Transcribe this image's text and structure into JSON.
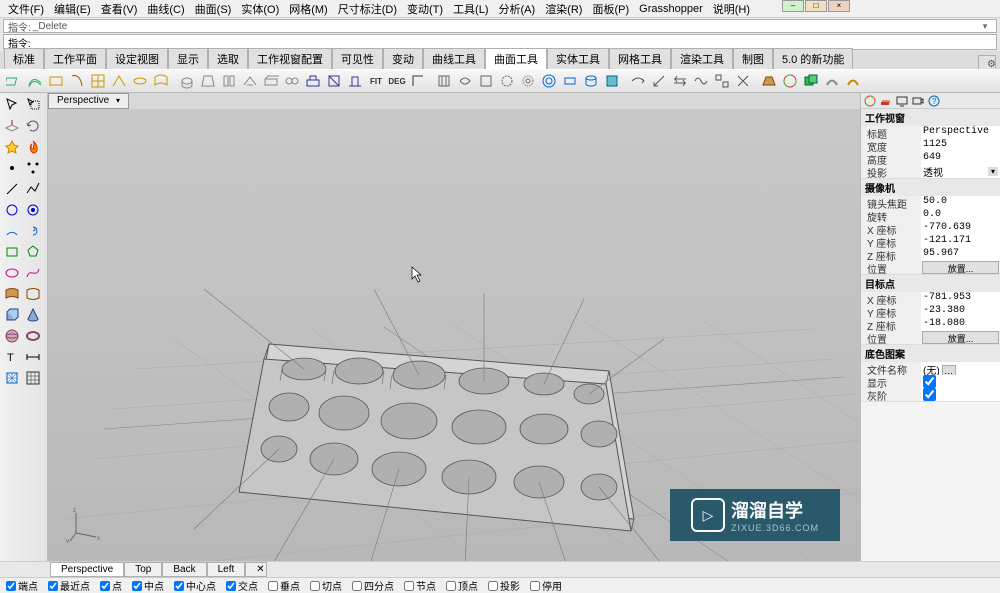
{
  "menu": [
    "文件(F)",
    "编辑(E)",
    "查看(V)",
    "曲线(C)",
    "曲面(S)",
    "实体(O)",
    "网格(M)",
    "尺寸标注(D)",
    "变动(T)",
    "工具(L)",
    "分析(A)",
    "渲染(R)",
    "面板(P)",
    "Grasshopper",
    "说明(H)"
  ],
  "cmd_history": {
    "label": "指令:",
    "last": "_Delete"
  },
  "cmd": {
    "label": "指令:",
    "value": ""
  },
  "tabs": [
    "标准",
    "工作平面",
    "设定视图",
    "显示",
    "选取",
    "工作视窗配置",
    "可见性",
    "变动",
    "曲线工具",
    "曲面工具",
    "实体工具",
    "网格工具",
    "渲染工具",
    "制图",
    "5.0 的新功能"
  ],
  "active_tab": 9,
  "viewport_tab": "Perspective",
  "bottom_tabs": [
    "Perspective",
    "Top",
    "Back",
    "Left"
  ],
  "active_bottom": 0,
  "props": {
    "viewport": {
      "title": "工作视窗",
      "rows": [
        {
          "k": "标题",
          "v": "Perspective"
        },
        {
          "k": "宽度",
          "v": "1125"
        },
        {
          "k": "高度",
          "v": "649"
        },
        {
          "k": "投影",
          "v": "透视",
          "drop": true
        }
      ]
    },
    "camera": {
      "title": "摄像机",
      "rows": [
        {
          "k": "镜头焦距",
          "v": "50.0"
        },
        {
          "k": "旋转",
          "v": "0.0"
        },
        {
          "k": "X 座标",
          "v": "-770.639"
        },
        {
          "k": "Y 座标",
          "v": "-121.171"
        },
        {
          "k": "Z 座标",
          "v": "95.967"
        },
        {
          "k": "位置",
          "btn": "放置..."
        }
      ]
    },
    "target": {
      "title": "目标点",
      "rows": [
        {
          "k": "X 座标",
          "v": "-781.953"
        },
        {
          "k": "Y 座标",
          "v": "-23.380"
        },
        {
          "k": "Z 座标",
          "v": "-18.080"
        },
        {
          "k": "位置",
          "btn": "放置..."
        }
      ]
    },
    "wallpaper": {
      "title": "底色图案",
      "rows": [
        {
          "k": "文件名称",
          "v": "(无)",
          "ell": true
        },
        {
          "k": "显示",
          "chk": true
        },
        {
          "k": "灰阶",
          "chk": true
        }
      ]
    }
  },
  "status_snaps": [
    {
      "label": "端点",
      "checked": true
    },
    {
      "label": "最近点",
      "checked": true
    },
    {
      "label": "点",
      "checked": true
    },
    {
      "label": "中点",
      "checked": true
    },
    {
      "label": "中心点",
      "checked": true
    },
    {
      "label": "交点",
      "checked": true
    },
    {
      "label": "垂点",
      "checked": false
    },
    {
      "label": "切点",
      "checked": false
    },
    {
      "label": "四分点",
      "checked": false
    },
    {
      "label": "节点",
      "checked": false
    },
    {
      "label": "顶点",
      "checked": false
    },
    {
      "label": "投影",
      "checked": false
    },
    {
      "label": "停用",
      "checked": false
    }
  ],
  "watermark": {
    "brand": "溜溜自学",
    "sub": "ZIXUE.3D66.COM"
  },
  "axes": {
    "x": "x",
    "y": "y",
    "z": "z"
  }
}
